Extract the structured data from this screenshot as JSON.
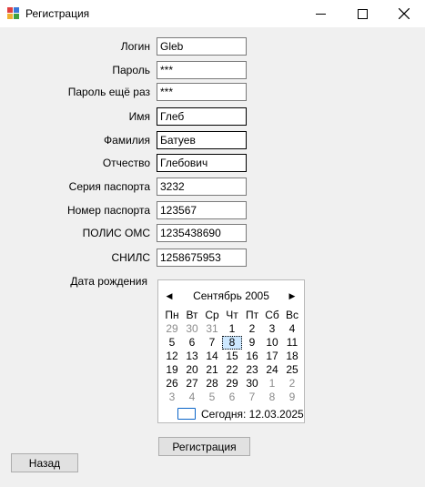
{
  "window": {
    "title": "Регистрация"
  },
  "form": {
    "login": {
      "label": "Логин",
      "value": "Gleb"
    },
    "password": {
      "label": "Пароль",
      "value": "***"
    },
    "password2": {
      "label": "Пароль ещё раз",
      "value": "***"
    },
    "first_name": {
      "label": "Имя",
      "value": "Глеб"
    },
    "last_name": {
      "label": "Фамилия",
      "value": "Батуев"
    },
    "patronymic": {
      "label": "Отчество",
      "value": "Глебович"
    },
    "passport_series": {
      "label": "Серия паспорта",
      "value": "3232"
    },
    "passport_number": {
      "label": "Номер паспорта",
      "value": "123567"
    },
    "oms": {
      "label": "ПОЛИС ОМС",
      "value": "1235438690"
    },
    "snils": {
      "label": "СНИЛС",
      "value": "1258675953"
    },
    "birth_label": "Дата рождения"
  },
  "calendar": {
    "month_title": "Сентябрь 2005",
    "weekdays": [
      "Пн",
      "Вт",
      "Ср",
      "Чт",
      "Пт",
      "Сб",
      "Вс"
    ],
    "weeks": [
      [
        {
          "d": "29",
          "o": true
        },
        {
          "d": "30",
          "o": true
        },
        {
          "d": "31",
          "o": true
        },
        {
          "d": "1"
        },
        {
          "d": "2"
        },
        {
          "d": "3"
        },
        {
          "d": "4"
        }
      ],
      [
        {
          "d": "5"
        },
        {
          "d": "6"
        },
        {
          "d": "7"
        },
        {
          "d": "8",
          "sel": true
        },
        {
          "d": "9"
        },
        {
          "d": "10"
        },
        {
          "d": "11"
        }
      ],
      [
        {
          "d": "12"
        },
        {
          "d": "13"
        },
        {
          "d": "14"
        },
        {
          "d": "15"
        },
        {
          "d": "16"
        },
        {
          "d": "17"
        },
        {
          "d": "18"
        }
      ],
      [
        {
          "d": "19"
        },
        {
          "d": "20"
        },
        {
          "d": "21"
        },
        {
          "d": "22"
        },
        {
          "d": "23"
        },
        {
          "d": "24"
        },
        {
          "d": "25"
        }
      ],
      [
        {
          "d": "26"
        },
        {
          "d": "27"
        },
        {
          "d": "28"
        },
        {
          "d": "29"
        },
        {
          "d": "30"
        },
        {
          "d": "1",
          "o": true
        },
        {
          "d": "2",
          "o": true
        }
      ],
      [
        {
          "d": "3",
          "o": true
        },
        {
          "d": "4",
          "o": true
        },
        {
          "d": "5",
          "o": true
        },
        {
          "d": "6",
          "o": true
        },
        {
          "d": "7",
          "o": true
        },
        {
          "d": "8",
          "o": true
        },
        {
          "d": "9",
          "o": true
        }
      ]
    ],
    "today_label": "Сегодня: 12.03.2025",
    "selection_color": "#cde8ff",
    "today_color": "#0a64c8"
  },
  "buttons": {
    "register": "Регистрация",
    "back": "Назад"
  }
}
